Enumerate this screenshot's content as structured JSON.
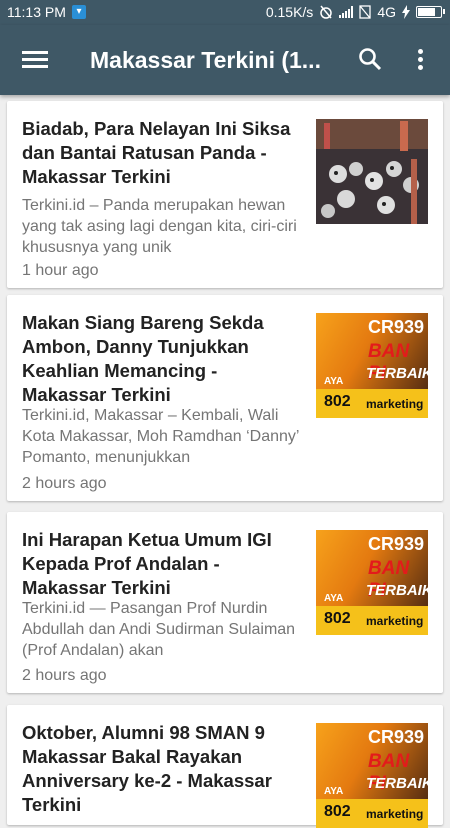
{
  "status_bar": {
    "time": "11:13 PM",
    "network_speed": "0.15K/s",
    "network_type": "4G"
  },
  "app_bar": {
    "title": "Makassar Terkini (1...",
    "color": "#3f5866"
  },
  "articles": [
    {
      "title": "Biadab, Para Nelayan Ini Siksa dan Bantai Ratusan Panda - Makassar Terkini",
      "snippet": "Terkini.id – Panda merupakan hewan yang tak asing lagi dengan kita, ciri-ciri khususnya yang unik",
      "time": "1 hour ago",
      "thumbnail": "panda-photo"
    },
    {
      "title": "Makan Siang Bareng Sekda Ambon, Danny Tunjukkan Keahlian Memancing - Makassar Terkini",
      "snippet": "Terkini.id, Makassar – Kembali, Wali Kota Makassar, Moh Ramdhan ‘Danny’ Pomanto, menunjukkan",
      "time": "2 hours ago",
      "thumbnail": "tire-ad"
    },
    {
      "title": "Ini Harapan Ketua Umum IGI Kepada Prof Andalan - Makassar Terkini",
      "snippet": "Terkini.id — Pasangan Prof Nurdin Abdullah dan Andi Sudirman Sulaiman (Prof Andalan) akan",
      "time": "2 hours ago",
      "thumbnail": "tire-ad"
    },
    {
      "title": "Oktober, Alumni 98 SMAN 9 Makassar Bakal Rayakan Anniversary ke-2 - Makassar Terkini",
      "snippet": "",
      "time": "",
      "thumbnail": "tire-ad"
    }
  ],
  "ad": {
    "code": "CR939",
    "ban": "BAN PI",
    "terbaik": "TERBAIK",
    "aya": "AYA",
    "number": "802",
    "marketing": "marketing"
  }
}
